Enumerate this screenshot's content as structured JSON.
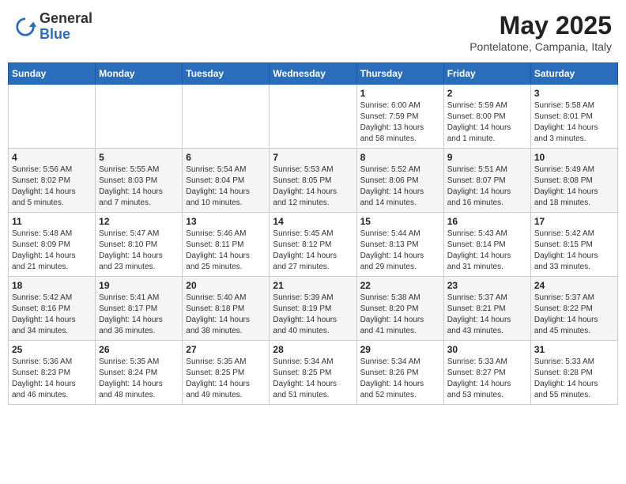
{
  "header": {
    "logo_general": "General",
    "logo_blue": "Blue",
    "title": "May 2025",
    "subtitle": "Pontelatone, Campania, Italy"
  },
  "weekdays": [
    "Sunday",
    "Monday",
    "Tuesday",
    "Wednesday",
    "Thursday",
    "Friday",
    "Saturday"
  ],
  "weeks": [
    [
      {
        "day": "",
        "info": ""
      },
      {
        "day": "",
        "info": ""
      },
      {
        "day": "",
        "info": ""
      },
      {
        "day": "",
        "info": ""
      },
      {
        "day": "1",
        "info": "Sunrise: 6:00 AM\nSunset: 7:59 PM\nDaylight: 13 hours\nand 58 minutes."
      },
      {
        "day": "2",
        "info": "Sunrise: 5:59 AM\nSunset: 8:00 PM\nDaylight: 14 hours\nand 1 minute."
      },
      {
        "day": "3",
        "info": "Sunrise: 5:58 AM\nSunset: 8:01 PM\nDaylight: 14 hours\nand 3 minutes."
      }
    ],
    [
      {
        "day": "4",
        "info": "Sunrise: 5:56 AM\nSunset: 8:02 PM\nDaylight: 14 hours\nand 5 minutes."
      },
      {
        "day": "5",
        "info": "Sunrise: 5:55 AM\nSunset: 8:03 PM\nDaylight: 14 hours\nand 7 minutes."
      },
      {
        "day": "6",
        "info": "Sunrise: 5:54 AM\nSunset: 8:04 PM\nDaylight: 14 hours\nand 10 minutes."
      },
      {
        "day": "7",
        "info": "Sunrise: 5:53 AM\nSunset: 8:05 PM\nDaylight: 14 hours\nand 12 minutes."
      },
      {
        "day": "8",
        "info": "Sunrise: 5:52 AM\nSunset: 8:06 PM\nDaylight: 14 hours\nand 14 minutes."
      },
      {
        "day": "9",
        "info": "Sunrise: 5:51 AM\nSunset: 8:07 PM\nDaylight: 14 hours\nand 16 minutes."
      },
      {
        "day": "10",
        "info": "Sunrise: 5:49 AM\nSunset: 8:08 PM\nDaylight: 14 hours\nand 18 minutes."
      }
    ],
    [
      {
        "day": "11",
        "info": "Sunrise: 5:48 AM\nSunset: 8:09 PM\nDaylight: 14 hours\nand 21 minutes."
      },
      {
        "day": "12",
        "info": "Sunrise: 5:47 AM\nSunset: 8:10 PM\nDaylight: 14 hours\nand 23 minutes."
      },
      {
        "day": "13",
        "info": "Sunrise: 5:46 AM\nSunset: 8:11 PM\nDaylight: 14 hours\nand 25 minutes."
      },
      {
        "day": "14",
        "info": "Sunrise: 5:45 AM\nSunset: 8:12 PM\nDaylight: 14 hours\nand 27 minutes."
      },
      {
        "day": "15",
        "info": "Sunrise: 5:44 AM\nSunset: 8:13 PM\nDaylight: 14 hours\nand 29 minutes."
      },
      {
        "day": "16",
        "info": "Sunrise: 5:43 AM\nSunset: 8:14 PM\nDaylight: 14 hours\nand 31 minutes."
      },
      {
        "day": "17",
        "info": "Sunrise: 5:42 AM\nSunset: 8:15 PM\nDaylight: 14 hours\nand 33 minutes."
      }
    ],
    [
      {
        "day": "18",
        "info": "Sunrise: 5:42 AM\nSunset: 8:16 PM\nDaylight: 14 hours\nand 34 minutes."
      },
      {
        "day": "19",
        "info": "Sunrise: 5:41 AM\nSunset: 8:17 PM\nDaylight: 14 hours\nand 36 minutes."
      },
      {
        "day": "20",
        "info": "Sunrise: 5:40 AM\nSunset: 8:18 PM\nDaylight: 14 hours\nand 38 minutes."
      },
      {
        "day": "21",
        "info": "Sunrise: 5:39 AM\nSunset: 8:19 PM\nDaylight: 14 hours\nand 40 minutes."
      },
      {
        "day": "22",
        "info": "Sunrise: 5:38 AM\nSunset: 8:20 PM\nDaylight: 14 hours\nand 41 minutes."
      },
      {
        "day": "23",
        "info": "Sunrise: 5:37 AM\nSunset: 8:21 PM\nDaylight: 14 hours\nand 43 minutes."
      },
      {
        "day": "24",
        "info": "Sunrise: 5:37 AM\nSunset: 8:22 PM\nDaylight: 14 hours\nand 45 minutes."
      }
    ],
    [
      {
        "day": "25",
        "info": "Sunrise: 5:36 AM\nSunset: 8:23 PM\nDaylight: 14 hours\nand 46 minutes."
      },
      {
        "day": "26",
        "info": "Sunrise: 5:35 AM\nSunset: 8:24 PM\nDaylight: 14 hours\nand 48 minutes."
      },
      {
        "day": "27",
        "info": "Sunrise: 5:35 AM\nSunset: 8:25 PM\nDaylight: 14 hours\nand 49 minutes."
      },
      {
        "day": "28",
        "info": "Sunrise: 5:34 AM\nSunset: 8:25 PM\nDaylight: 14 hours\nand 51 minutes."
      },
      {
        "day": "29",
        "info": "Sunrise: 5:34 AM\nSunset: 8:26 PM\nDaylight: 14 hours\nand 52 minutes."
      },
      {
        "day": "30",
        "info": "Sunrise: 5:33 AM\nSunset: 8:27 PM\nDaylight: 14 hours\nand 53 minutes."
      },
      {
        "day": "31",
        "info": "Sunrise: 5:33 AM\nSunset: 8:28 PM\nDaylight: 14 hours\nand 55 minutes."
      }
    ]
  ]
}
